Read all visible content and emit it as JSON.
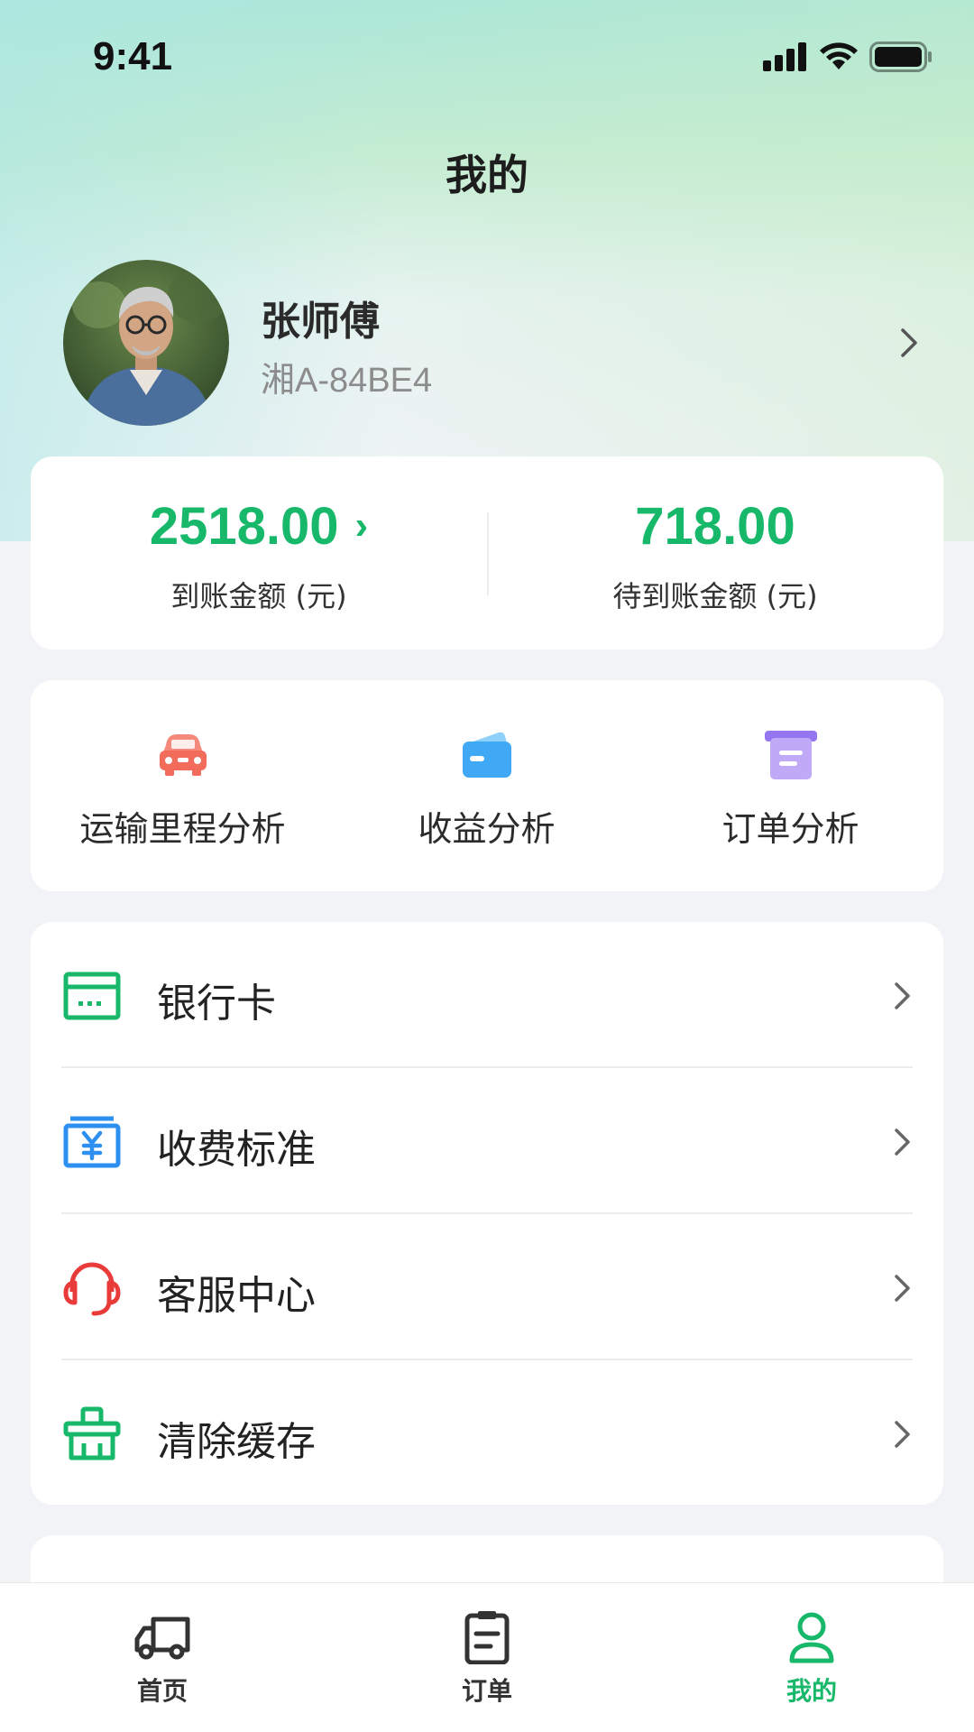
{
  "status_bar": {
    "time": "9:41"
  },
  "header": {
    "title": "我的"
  },
  "profile": {
    "name": "张师傅",
    "plate": "湘A-84BE4"
  },
  "balance": {
    "arrived_amount": "2518.00",
    "arrived_arrow": "›",
    "arrived_label": "到账金额 (元)",
    "pending_amount": "718.00",
    "pending_label": "待到账金额 (元)"
  },
  "analysis": {
    "items": [
      {
        "label": "运输里程分析",
        "icon": "car-icon",
        "color": "#f26b5b"
      },
      {
        "label": "收益分析",
        "icon": "wallet-icon",
        "color": "#3fa9f5"
      },
      {
        "label": "订单分析",
        "icon": "document-box-icon",
        "color": "#a98cf4"
      }
    ]
  },
  "menu": {
    "items": [
      {
        "label": "银行卡",
        "icon": "bank-card-icon",
        "color": "#17b86a"
      },
      {
        "label": "收费标准",
        "icon": "fee-standard-icon",
        "color": "#2d8ff0"
      },
      {
        "label": "客服中心",
        "icon": "headset-icon",
        "color": "#ea3b3b"
      },
      {
        "label": "清除缓存",
        "icon": "clear-cache-icon",
        "color": "#17b86a"
      }
    ]
  },
  "tab_bar": {
    "items": [
      {
        "label": "首页",
        "icon": "truck-icon",
        "active": false
      },
      {
        "label": "订单",
        "icon": "order-list-icon",
        "active": false
      },
      {
        "label": "我的",
        "icon": "user-icon",
        "active": true
      }
    ]
  },
  "colors": {
    "accent": "#17b86a",
    "background": "#f2f3f7"
  }
}
